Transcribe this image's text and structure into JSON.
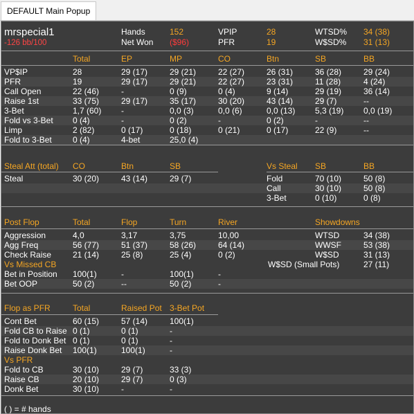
{
  "tab": {
    "label": "DEFAULT Main Popup"
  },
  "player": {
    "name": "mrspecial1",
    "bb_per_100": "-126 bb/100"
  },
  "summary": {
    "hands_label": "Hands",
    "hands": "152",
    "netwon_label": "Net Won",
    "netwon": "($96)",
    "vpip_label": "VPIP",
    "vpip": "28",
    "pfr_label": "PFR",
    "pfr": "19",
    "wtsd_label": "WTSD%",
    "wtsd": "34 (38)",
    "wssd_label": "W$SD%",
    "wssd": "31 (13)"
  },
  "preflop": {
    "headers": [
      "Total",
      "EP",
      "MP",
      "CO",
      "Btn",
      "SB",
      "BB"
    ],
    "rows": [
      [
        "VP$IP",
        "28",
        "29 (17)",
        "29 (21)",
        "22 (27)",
        "26 (31)",
        "36 (28)",
        "29 (24)"
      ],
      [
        "PFR",
        "19",
        "29 (17)",
        "29 (21)",
        "22 (27)",
        "23 (31)",
        "11 (28)",
        "4 (24)"
      ],
      [
        "Call Open",
        "22 (46)",
        "-",
        "0 (9)",
        "0 (4)",
        "9 (14)",
        "29 (19)",
        "36 (14)"
      ],
      [
        "Raise 1st",
        "33 (75)",
        "29 (17)",
        "35 (17)",
        "30 (20)",
        "43 (14)",
        "29 (7)",
        "--"
      ],
      [
        "3-Bet",
        "1,7 (60)",
        "-",
        "0,0 (3)",
        "0,0 (6)",
        "0,0 (13)",
        "5,3 (19)",
        "0,0 (19)"
      ],
      [
        "Fold vs 3-Bet",
        "0 (4)",
        "-",
        "0 (2)",
        "-",
        "0 (2)",
        "-",
        "--"
      ],
      [
        "Limp",
        "2 (82)",
        "0 (17)",
        "0 (18)",
        "0 (21)",
        "0 (17)",
        "22 (9)",
        "--"
      ],
      [
        "Fold to 3-Bet",
        "0 (4)",
        "4-bet",
        "25,0 (4)",
        "",
        "",
        "",
        ""
      ]
    ]
  },
  "steal": {
    "title": "Steal Att (total)",
    "headers": [
      "CO",
      "Btn",
      "SB"
    ],
    "row": [
      "Steal",
      "30 (20)",
      "43 (14)",
      "29 (7)"
    ],
    "vs_title": "Vs Steal",
    "vs_headers": [
      "SB",
      "BB"
    ],
    "vs_rows": [
      [
        "Fold",
        "70 (10)",
        "50 (8)"
      ],
      [
        "Call",
        "30 (10)",
        "50 (8)"
      ],
      [
        "3-Bet",
        "0 (10)",
        "0 (8)"
      ]
    ]
  },
  "postflop": {
    "title": "Post Flop",
    "headers": [
      "Total",
      "Flop",
      "Turn",
      "River"
    ],
    "rows": [
      [
        "Aggression",
        "4,0",
        "3,17",
        "3,75",
        "10,00"
      ],
      [
        "Agg Freq",
        "56 (77)",
        "51 (37)",
        "58 (26)",
        "64 (14)"
      ],
      [
        "Check Raise",
        "21 (14)",
        "25 (8)",
        "25 (4)",
        "0 (2)"
      ]
    ],
    "missed_title": "Vs Missed CB",
    "missed_rows": [
      [
        "Bet in Position",
        "100(1)",
        "-",
        "100(1)",
        "-"
      ],
      [
        "Bet OOP",
        "50 (2)",
        "--",
        "50 (2)",
        "-"
      ]
    ],
    "sd_title": "Showdowns",
    "sd_rows": [
      [
        "WTSD",
        "34 (38)"
      ],
      [
        "WWSF",
        "53 (38)"
      ],
      [
        "W$SD",
        "31 (13)"
      ],
      [
        "W$SD (Small Pots)",
        "27 (11)"
      ]
    ]
  },
  "pfr_section": {
    "title": "Flop as PFR",
    "headers": [
      "Total",
      "Raised Pot",
      "3-Bet Pot"
    ],
    "rows": [
      [
        "Cont Bet",
        "60 (15)",
        "57 (14)",
        "100(1)"
      ],
      [
        "Fold CB to Raise",
        "0 (1)",
        "0 (1)",
        "-"
      ],
      [
        "Fold to Donk Bet",
        "0 (1)",
        "0 (1)",
        "-"
      ],
      [
        "Raise Donk Bet",
        "100(1)",
        "100(1)",
        "-"
      ]
    ],
    "vs_title": "Vs PFR",
    "vs_rows": [
      [
        "Fold to CB",
        "30 (10)",
        "29 (7)",
        "33 (3)"
      ],
      [
        "Raise CB",
        "20 (10)",
        "29 (7)",
        "0 (3)"
      ],
      [
        "Donk Bet",
        "30 (10)",
        "-",
        "-"
      ]
    ]
  },
  "footer": {
    "note": "( ) = # hands"
  }
}
